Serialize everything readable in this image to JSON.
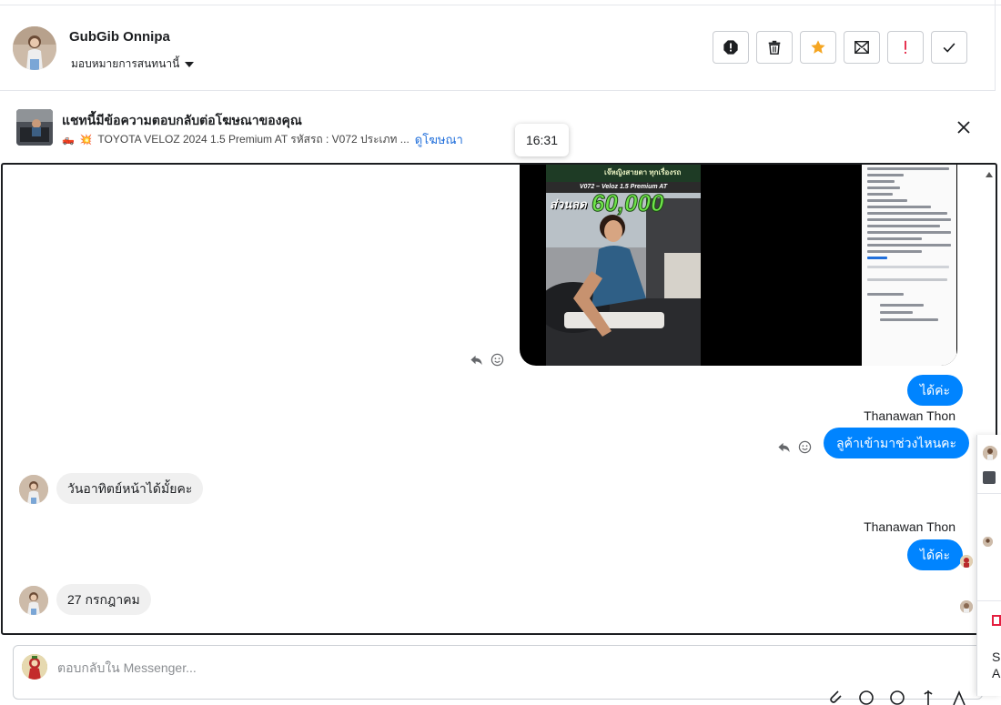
{
  "header": {
    "name": "GubGib Onnipa",
    "assign_label": "มอบหมายการสนทนานี้",
    "actions": [
      "spam-icon",
      "trash-icon",
      "star-icon",
      "mark-unread-icon",
      "exclamation-icon",
      "check-icon"
    ],
    "accent_star": "#f5a623",
    "accent_alert": "#e41e3f"
  },
  "banner": {
    "title": "แชทนี้มีข้อความตอบกลับต่อโฆษณาของคุณ",
    "ad_text": "TOYOTA VELOZ 2024 1.5 Premium AT รหัสรถ : V072 ประเภท ...",
    "view_ad": "ดูโฆษณา"
  },
  "tooltip": {
    "time": "16:31"
  },
  "media": {
    "brand": "เจ๊หญิงสายตา ทุกเรื่องรถ",
    "model": "V072 – Veloz 1.5 Premium AT",
    "sale_word": "ส่วนลด",
    "sale_amount": "60,000"
  },
  "messages": {
    "out1": "ได้ค่ะ",
    "sender1": "Thanawan Thon",
    "out2": "ลูค้าเข้ามาช่วงไหนคะ",
    "in1": "วันอาทิตย์หน้าได้มั้ยคะ",
    "sender2": "Thanawan Thon",
    "out3": "ได้ค่ะ",
    "in2": "27 กรกฎาคม"
  },
  "composer": {
    "placeholder": "ตอบกลับใน Messenger..."
  },
  "right_panel": {
    "line1": "So",
    "line2": "A"
  },
  "colors": {
    "bubble_out": "#0084ff",
    "bubble_in": "#f0f0f0",
    "link": "#216fdb"
  }
}
